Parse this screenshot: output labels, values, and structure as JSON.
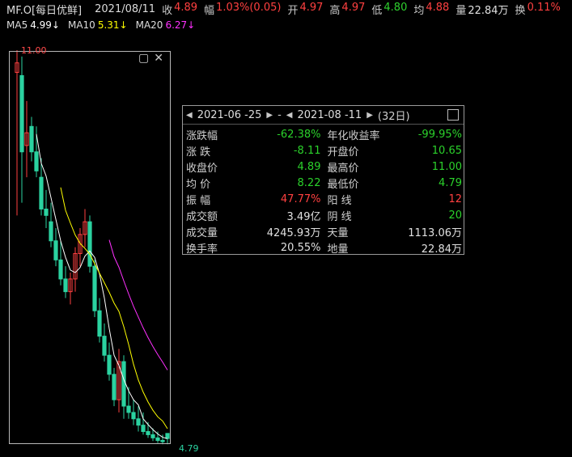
{
  "header": {
    "symbol": "MF.O[每日优鲜]",
    "date": "2021/08/11",
    "close_label": "收",
    "close_value": "4.89",
    "change_label": "幅",
    "change_value": "1.03%(0.05)",
    "open_label": "开",
    "open_value": "4.97",
    "high_label": "高",
    "high_value": "4.97",
    "low_label": "低",
    "low_value": "4.80",
    "avg_label": "均",
    "avg_value": "4.88",
    "vol_label": "量",
    "vol_value": "22.84万",
    "turnover_label": "换",
    "turnover_value": "0.11%"
  },
  "ma": {
    "ma5_label": "MA5",
    "ma5_value": "4.99↓",
    "ma10_label": "MA10",
    "ma10_value": "5.31↓",
    "ma20_label": "MA20",
    "ma20_value": "6.27↓"
  },
  "chart": {
    "high_label": "11.00",
    "low_label": "4.79"
  },
  "panel": {
    "nav": {
      "start_date": "2021-06 -25",
      "separator": "-",
      "end_date": "2021-08 -11",
      "days": "(32日)"
    },
    "rows": [
      {
        "k1": "涨跌幅",
        "v1": "-62.38%",
        "k2": "年化收益率",
        "v2": "-99.95%"
      },
      {
        "k1": "涨  跌",
        "v1": "-8.11",
        "k2": "开盘价",
        "v2": "10.65"
      },
      {
        "k1": "收盘价",
        "v1": "4.89",
        "k2": "最高价",
        "v2": "11.00"
      },
      {
        "k1": "均  价",
        "v1": "8.22",
        "k2": "最低价",
        "v2": "4.79"
      },
      {
        "k1": "振  幅",
        "v1": "47.77%",
        "k2": "阳  线",
        "v2": "12"
      },
      {
        "k1": "成交额",
        "v1": "3.49亿",
        "k2": "阴  线",
        "v2": "20"
      },
      {
        "k1": "成交量",
        "v1": "4245.93万",
        "k2": "天量",
        "v2": "1113.06万"
      },
      {
        "k1": "换手率",
        "v1": "20.55%",
        "k2": "地量",
        "v2": "22.84万"
      }
    ]
  },
  "colors": {
    "up": "#ff4040",
    "down": "#2bd2a0",
    "ma5": "#ffffff",
    "ma10": "#ffff00",
    "ma20": "#ff30ff"
  },
  "chart_data": {
    "type": "line",
    "title": "",
    "xlabel": "",
    "ylabel": "",
    "candles": [
      {
        "o": 10.65,
        "h": 11.0,
        "l": 8.4,
        "c": 10.8
      },
      {
        "o": 10.6,
        "h": 10.9,
        "l": 8.6,
        "c": 9.4
      },
      {
        "o": 9.5,
        "h": 10.2,
        "l": 9.0,
        "c": 9.7
      },
      {
        "o": 9.8,
        "h": 9.95,
        "l": 9.25,
        "c": 9.4
      },
      {
        "o": 9.4,
        "h": 9.8,
        "l": 9.0,
        "c": 9.1
      },
      {
        "o": 9.0,
        "h": 9.3,
        "l": 8.4,
        "c": 8.5
      },
      {
        "o": 8.5,
        "h": 8.8,
        "l": 8.2,
        "c": 8.4
      },
      {
        "o": 8.3,
        "h": 8.6,
        "l": 7.9,
        "c": 8.0
      },
      {
        "o": 8.0,
        "h": 8.2,
        "l": 7.6,
        "c": 7.7
      },
      {
        "o": 7.7,
        "h": 8.0,
        "l": 7.3,
        "c": 7.4
      },
      {
        "o": 7.4,
        "h": 7.6,
        "l": 7.1,
        "c": 7.2
      },
      {
        "o": 7.2,
        "h": 7.5,
        "l": 7.0,
        "c": 7.4
      },
      {
        "o": 7.4,
        "h": 7.9,
        "l": 7.2,
        "c": 7.8
      },
      {
        "o": 7.8,
        "h": 8.2,
        "l": 7.6,
        "c": 8.1
      },
      {
        "o": 8.1,
        "h": 8.5,
        "l": 7.9,
        "c": 8.3
      },
      {
        "o": 8.3,
        "h": 8.4,
        "l": 7.5,
        "c": 7.6
      },
      {
        "o": 7.6,
        "h": 7.7,
        "l": 6.8,
        "c": 6.9
      },
      {
        "o": 6.9,
        "h": 7.1,
        "l": 6.4,
        "c": 6.5
      },
      {
        "o": 6.5,
        "h": 6.7,
        "l": 6.1,
        "c": 6.2
      },
      {
        "o": 6.2,
        "h": 6.4,
        "l": 5.8,
        "c": 5.9
      },
      {
        "o": 5.9,
        "h": 6.0,
        "l": 5.4,
        "c": 5.5
      },
      {
        "o": 5.5,
        "h": 6.3,
        "l": 5.3,
        "c": 6.1
      },
      {
        "o": 6.1,
        "h": 6.2,
        "l": 5.2,
        "c": 5.4
      },
      {
        "o": 5.4,
        "h": 5.7,
        "l": 5.2,
        "c": 5.3
      },
      {
        "o": 5.3,
        "h": 5.5,
        "l": 5.1,
        "c": 5.2
      },
      {
        "o": 5.2,
        "h": 5.4,
        "l": 5.0,
        "c": 5.1
      },
      {
        "o": 5.1,
        "h": 5.3,
        "l": 4.95,
        "c": 5.0
      },
      {
        "o": 5.0,
        "h": 5.15,
        "l": 4.9,
        "c": 4.95
      },
      {
        "o": 4.95,
        "h": 5.05,
        "l": 4.85,
        "c": 4.9
      },
      {
        "o": 4.9,
        "h": 5.0,
        "l": 4.82,
        "c": 4.86
      },
      {
        "o": 4.86,
        "h": 4.95,
        "l": 4.8,
        "c": 4.84
      },
      {
        "o": 4.97,
        "h": 4.97,
        "l": 4.8,
        "c": 4.89
      }
    ],
    "ylim": [
      4.79,
      11.0
    ]
  }
}
